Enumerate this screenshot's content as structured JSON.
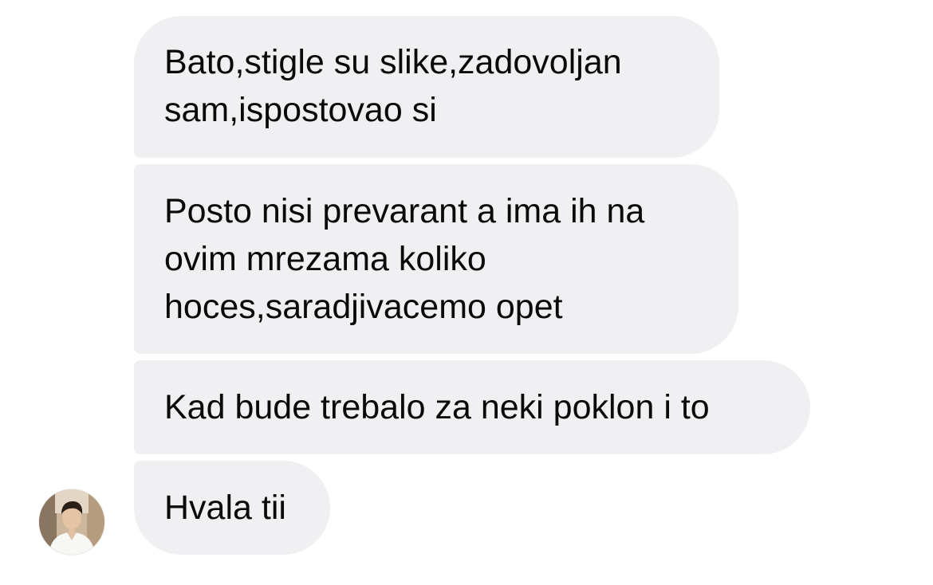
{
  "conversation": {
    "messages": [
      {
        "text": "Bato,stigle su slike,zadovoljan\nsam,ispostovao si"
      },
      {
        "text": "Posto nisi prevarant a ima ih na\novim mrezama koliko\nhoces,saradjivacemo opet"
      },
      {
        "text": "Kad bude trebalo za neki poklon i to"
      },
      {
        "text": "Hvala tii"
      }
    ],
    "bubble_color": "#f0f0f3",
    "text_color": "#0a0a0a",
    "avatar_icon": "user-avatar-photo"
  }
}
